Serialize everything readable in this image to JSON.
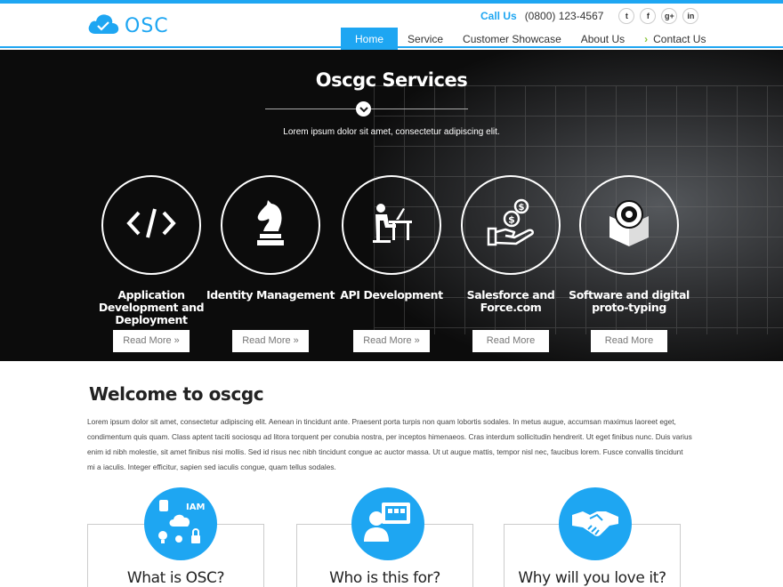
{
  "brand": {
    "name": "OSC",
    "accent": "#1ea6f2"
  },
  "contact": {
    "call_label": "Call Us",
    "phone": "(0800) 123-4567"
  },
  "socials": [
    {
      "icon": "twitter-icon",
      "glyph": "t"
    },
    {
      "icon": "facebook-icon",
      "glyph": "f"
    },
    {
      "icon": "google-plus-icon",
      "glyph": "g+"
    },
    {
      "icon": "linkedin-icon",
      "glyph": "in"
    }
  ],
  "nav": {
    "items": [
      {
        "label": "Home",
        "active": true
      },
      {
        "label": "Service"
      },
      {
        "label": "Customer Showcase"
      },
      {
        "label": "About Us"
      },
      {
        "label": "Contact Us"
      }
    ]
  },
  "hero": {
    "title": "Oscgc Services",
    "subtitle": "Lorem ipsum dolor sit amet, consectetur adipiscing elit.",
    "services": [
      {
        "title": "Application Development and Deployment",
        "icon": "code-icon",
        "button": "Read More »"
      },
      {
        "title": "Identity Management",
        "icon": "chess-knight-icon",
        "button": "Read More »"
      },
      {
        "title": "API Development",
        "icon": "developer-desk-icon",
        "button": "Read More »"
      },
      {
        "title": "Salesforce and Force.com",
        "icon": "money-hand-icon",
        "button": "Read More"
      },
      {
        "title": "Software and digital proto-typing",
        "icon": "prototype-box-icon",
        "button": "Read More"
      }
    ]
  },
  "welcome": {
    "title": "Welcome to oscgc",
    "paragraph": "Lorem ipsum dolor sit amet, consectetur adipiscing elit. Aenean in tincidunt ante. Praesent porta turpis non quam lobortis sodales. In metus augue, accumsan maximus laoreet eget, condimentum quis quam. Class aptent taciti sociosqu ad litora torquent per conubia nostra, per inceptos himenaeos. Cras interdum sollicitudin hendrerit. Ut eget finibus nunc. Duis varius enim id nibh molestie, sit amet finibus nisi mollis. Sed id risus nec nibh tincidunt congue ac auctor massa. Ut ut augue mattis, tempor nisl nec, faucibus lorem. Fusce convallis tincidunt mi a iaculis. Integer efficitur, sapien sed iaculis congue, quam tellus sodales."
  },
  "cards": [
    {
      "title": "What is OSC?",
      "icon": "iam-cloud-icon",
      "icon_text": "IAM"
    },
    {
      "title": "Who is this for?",
      "icon": "user-screen-icon"
    },
    {
      "title": "Why will you love it?",
      "icon": "handshake-icon"
    }
  ]
}
